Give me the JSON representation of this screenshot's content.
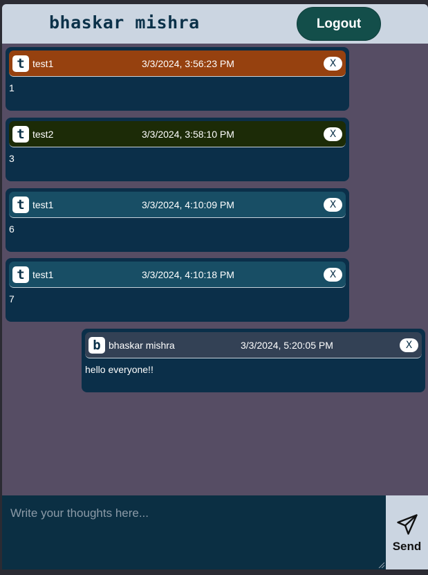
{
  "header": {
    "user_name": "bhaskar mishra",
    "logout_label": "Logout"
  },
  "messages": [
    {
      "initial": "t",
      "author": "test1",
      "time": "3/3/2024, 3:56:23 PM",
      "text": "1",
      "close_label": "X",
      "head_color": "#96410f"
    },
    {
      "initial": "t",
      "author": "test2",
      "time": "3/3/2024, 3:58:10 PM",
      "text": "3",
      "close_label": "X",
      "head_color": "#1c2b07"
    },
    {
      "initial": "t",
      "author": "test1",
      "time": "3/3/2024, 4:10:09 PM",
      "text": "6",
      "close_label": "X",
      "head_color": "#184e65"
    },
    {
      "initial": "t",
      "author": "test1",
      "time": "3/3/2024, 4:10:18 PM",
      "text": "7",
      "close_label": "X",
      "head_color": "#184e65"
    },
    {
      "initial": "b",
      "author": "bhaskar mishra",
      "time": "3/3/2024, 5:20:05 PM",
      "text": "hello everyone!!",
      "close_label": "X",
      "head_color": "#334155"
    }
  ],
  "composer": {
    "placeholder": "Write your thoughts here...",
    "send_label": "Send"
  },
  "colors": {
    "background": "#564d64",
    "header": "#cbd5e1",
    "card": "#0b2f49",
    "composer": "#0b2f43",
    "logout": "#134e4a"
  }
}
